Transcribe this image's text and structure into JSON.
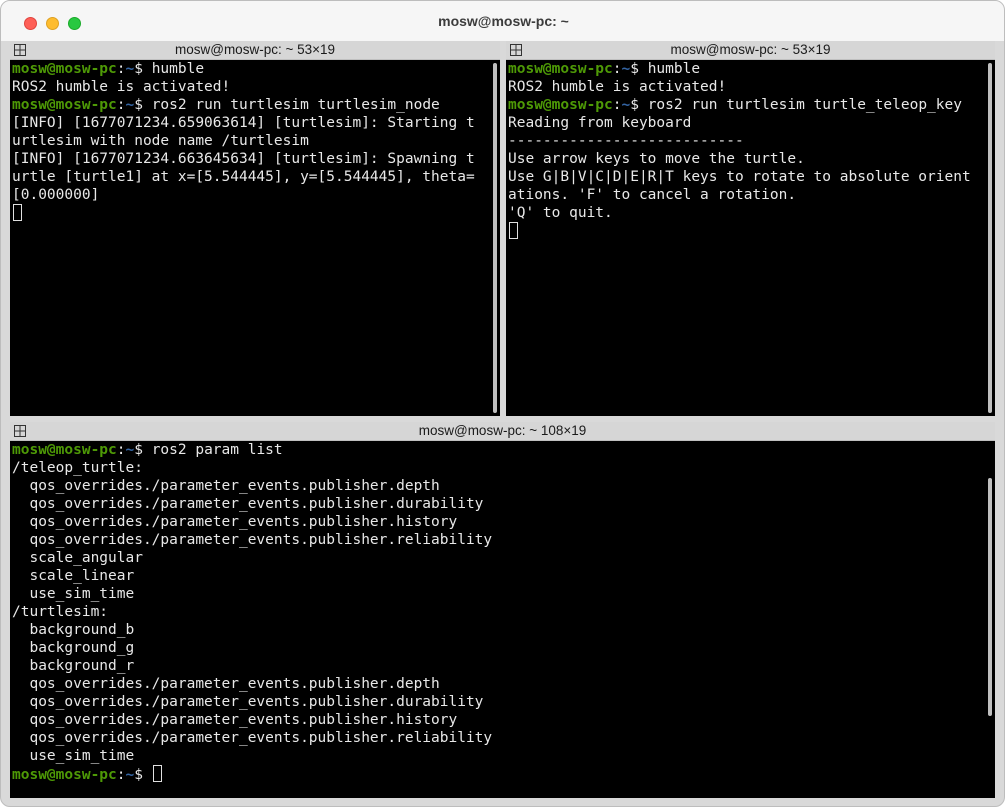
{
  "window": {
    "title": "mosw@mosw-pc: ~"
  },
  "panes": {
    "top_left": {
      "title": "mosw@mosw-pc: ~ 53×19",
      "lines": [
        {
          "user": "mosw@mosw-pc",
          "sep": ":",
          "path": "~",
          "rest": "$ humble"
        },
        {
          "text": "ROS2 humble is activated!"
        },
        {
          "user": "mosw@mosw-pc",
          "sep": ":",
          "path": "~",
          "rest": "$ ros2 run turtlesim turtlesim_node"
        },
        {
          "text": "[INFO] [1677071234.659063614] [turtlesim]: Starting t"
        },
        {
          "text": "urtlesim with node name /turtlesim"
        },
        {
          "text": "[INFO] [1677071234.663645634] [turtlesim]: Spawning t"
        },
        {
          "text": "urtle [turtle1] at x=[5.544445], y=[5.544445], theta="
        },
        {
          "text": "[0.000000]"
        }
      ]
    },
    "top_right": {
      "title": "mosw@mosw-pc: ~ 53×19",
      "lines": [
        {
          "user": "mosw@mosw-pc",
          "sep": ":",
          "path": "~",
          "rest": "$ humble"
        },
        {
          "text": "ROS2 humble is activated!"
        },
        {
          "user": "mosw@mosw-pc",
          "sep": ":",
          "path": "~",
          "rest": "$ ros2 run turtlesim turtle_teleop_key"
        },
        {
          "text": "Reading from keyboard"
        },
        {
          "text": "---------------------------"
        },
        {
          "text": "Use arrow keys to move the turtle."
        },
        {
          "text": "Use G|B|V|C|D|E|R|T keys to rotate to absolute orient"
        },
        {
          "text": "ations. 'F' to cancel a rotation."
        },
        {
          "text": "'Q' to quit."
        }
      ]
    },
    "bottom": {
      "title": "mosw@mosw-pc: ~ 108×19",
      "lines": [
        {
          "user": "mosw@mosw-pc",
          "sep": ":",
          "path": "~",
          "rest": "$ ros2 param list"
        },
        {
          "text": "/teleop_turtle:"
        },
        {
          "text": "  qos_overrides./parameter_events.publisher.depth"
        },
        {
          "text": "  qos_overrides./parameter_events.publisher.durability"
        },
        {
          "text": "  qos_overrides./parameter_events.publisher.history"
        },
        {
          "text": "  qos_overrides./parameter_events.publisher.reliability"
        },
        {
          "text": "  scale_angular"
        },
        {
          "text": "  scale_linear"
        },
        {
          "text": "  use_sim_time"
        },
        {
          "text": "/turtlesim:"
        },
        {
          "text": "  background_b"
        },
        {
          "text": "  background_g"
        },
        {
          "text": "  background_r"
        },
        {
          "text": "  qos_overrides./parameter_events.publisher.depth"
        },
        {
          "text": "  qos_overrides./parameter_events.publisher.durability"
        },
        {
          "text": "  qos_overrides./parameter_events.publisher.history"
        },
        {
          "text": "  qos_overrides./parameter_events.publisher.reliability"
        },
        {
          "text": "  use_sim_time"
        }
      ],
      "final_prompt": {
        "user": "mosw@mosw-pc",
        "sep": ":",
        "path": "~",
        "rest": "$ "
      }
    }
  },
  "colors": {
    "prompt_user": "#4e9a06",
    "prompt_path": "#3465a4",
    "terminal_bg": "#000000",
    "terminal_fg": "#e8e8e8"
  },
  "icons": {
    "traffic_lights": [
      "close-dot-icon",
      "minimize-dot-icon",
      "maximize-dot-icon"
    ],
    "pane_icon": "split-pane-icon"
  }
}
